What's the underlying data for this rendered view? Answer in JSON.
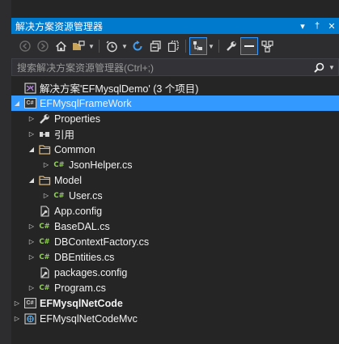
{
  "panel": {
    "title": "解决方案资源管理器",
    "pin_glyph": "▾",
    "autohide_glyph": "†",
    "close_glyph": "✕"
  },
  "search": {
    "placeholder": "搜索解决方案资源管理器(Ctrl+;)"
  },
  "tree": {
    "solution": "解决方案'EFMysqlDemo' (3 个项目)",
    "items": [
      {
        "label": "EFMysqlFrameWork",
        "icon": "csharp-project-icon"
      },
      {
        "label": "Properties",
        "icon": "wrench-icon"
      },
      {
        "label": "引用",
        "icon": "references-icon"
      },
      {
        "label": "Common",
        "icon": "folder-icon"
      },
      {
        "label": "JsonHelper.cs",
        "icon": "csharp-file-icon"
      },
      {
        "label": "Model",
        "icon": "folder-icon"
      },
      {
        "label": "User.cs",
        "icon": "csharp-file-icon"
      },
      {
        "label": "App.config",
        "icon": "config-file-icon"
      },
      {
        "label": "BaseDAL.cs",
        "icon": "csharp-file-icon"
      },
      {
        "label": "DBContextFactory.cs",
        "icon": "csharp-file-icon"
      },
      {
        "label": "DBEntities.cs",
        "icon": "csharp-file-icon"
      },
      {
        "label": "packages.config",
        "icon": "config-file-icon"
      },
      {
        "label": "Program.cs",
        "icon": "csharp-file-icon"
      },
      {
        "label": "EFMysqlNetCode",
        "icon": "csharp-project-icon"
      },
      {
        "label": "EFMysqlNetCodeMvc",
        "icon": "web-project-icon"
      }
    ],
    "cs_badge": "C#"
  },
  "colors": {
    "accent": "#007acc",
    "selection": "#3399ff",
    "background": "#252526",
    "csharp_green": "#8fd14f",
    "folder": "#dcb67a"
  }
}
